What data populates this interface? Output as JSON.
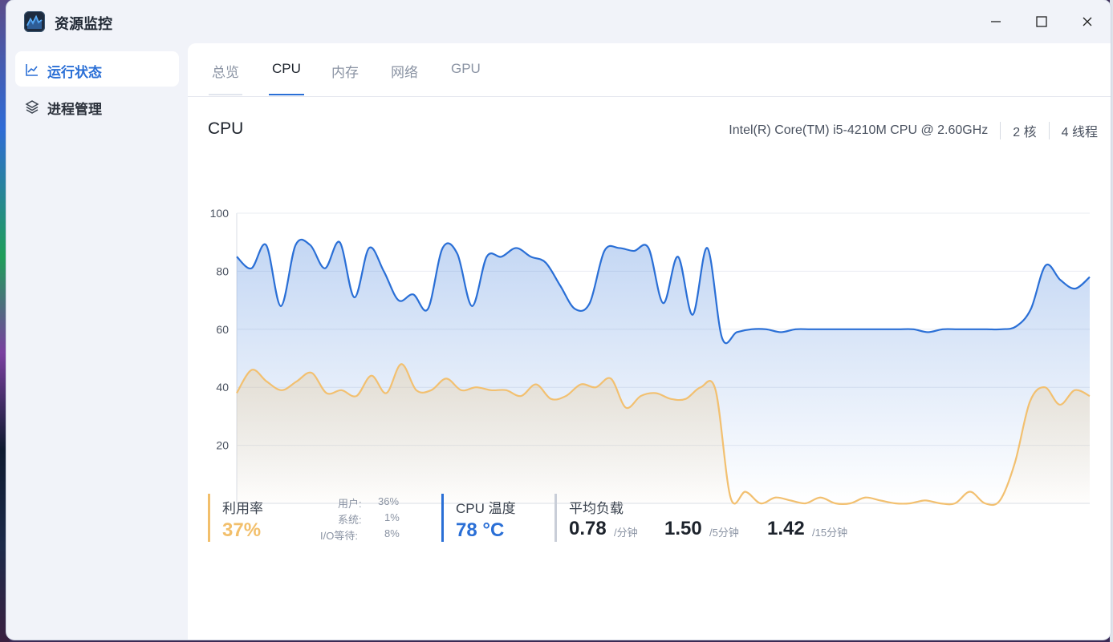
{
  "window": {
    "title": "资源监控"
  },
  "sidebar": {
    "items": [
      {
        "label": "运行状态",
        "icon": "line-chart-icon",
        "active": true
      },
      {
        "label": "进程管理",
        "icon": "layers-icon",
        "active": false
      }
    ]
  },
  "tabs": [
    "总览",
    "CPU",
    "内存",
    "网络",
    "GPU"
  ],
  "selected_tab": "CPU",
  "section": {
    "title": "CPU",
    "cpu_model": "Intel(R) Core(TM) i5-4210M CPU @ 2.60GHz",
    "cores": "2 核",
    "threads": "4 线程"
  },
  "chart_data": {
    "type": "area",
    "ylim": [
      0,
      100
    ],
    "yticks": [
      "100",
      "80",
      "60",
      "40",
      "20"
    ],
    "grid": true,
    "series": [
      {
        "color": "#2a6fd6",
        "values": [
          85,
          81,
          89,
          68,
          89,
          89,
          81,
          90,
          71,
          88,
          80,
          70,
          72,
          67,
          88,
          86,
          68,
          85,
          85,
          88,
          85,
          83,
          75,
          67,
          69,
          87,
          88,
          87,
          88,
          69,
          85,
          65,
          88,
          57,
          59,
          60,
          60,
          59,
          60,
          60,
          60,
          60,
          60,
          60,
          60,
          60,
          60,
          59,
          60,
          60,
          60,
          60,
          60,
          61,
          67,
          82,
          77,
          74,
          78
        ]
      },
      {
        "color": "#f2c070",
        "values": [
          38,
          46,
          42,
          39,
          42,
          45,
          38,
          39,
          37,
          44,
          38,
          48,
          39,
          39,
          43,
          39,
          40,
          39,
          39,
          37,
          41,
          36,
          37,
          41,
          40,
          43,
          33,
          37,
          38,
          36,
          36,
          40,
          39,
          2,
          4,
          0,
          2,
          1,
          0,
          2,
          0,
          0,
          2,
          1,
          0,
          0,
          1,
          0,
          0,
          4,
          0,
          1,
          14,
          35,
          40,
          34,
          39,
          37
        ]
      }
    ]
  },
  "stats": {
    "usage": {
      "label": "利用率",
      "value": "37%",
      "user_label": "用户:",
      "user_value": "36%",
      "system_label": "系统:",
      "system_value": "1%",
      "io_label": "I/O等待:",
      "io_value": "8%",
      "color": "#f2bf6b"
    },
    "temp": {
      "label": "CPU 温度",
      "value": "78 °C",
      "color": "#2a6fd6"
    },
    "load": {
      "label": "平均负载",
      "v1": "0.78",
      "u1": "/分钟",
      "v5": "1.50",
      "u5": "/5分钟",
      "v15": "1.42",
      "u15": "/15分钟",
      "color": "#c9ced8"
    }
  }
}
